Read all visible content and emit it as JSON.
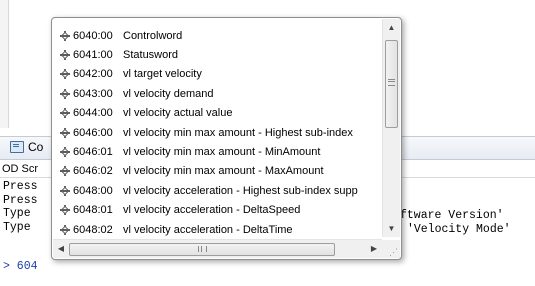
{
  "console": {
    "tab_label": "Co",
    "od_label": "OD Scr",
    "lines": [
      "Press",
      "Press",
      "Type",
      "Type"
    ],
    "right_text_1": "ftware Version'",
    "right_text_2": "'Velocity Mode'",
    "prompt": "> 604"
  },
  "popup": {
    "items": [
      {
        "index": "6040:00",
        "name": "Controlword"
      },
      {
        "index": "6041:00",
        "name": "Statusword"
      },
      {
        "index": "6042:00",
        "name": "vl target velocity"
      },
      {
        "index": "6043:00",
        "name": "vl velocity demand"
      },
      {
        "index": "6044:00",
        "name": "vl velocity actual value"
      },
      {
        "index": "6046:00",
        "name": "vl velocity min max amount - Highest sub-index"
      },
      {
        "index": "6046:01",
        "name": "vl velocity min max amount - MinAmount"
      },
      {
        "index": "6046:02",
        "name": "vl velocity min max amount - MaxAmount"
      },
      {
        "index": "6048:00",
        "name": "vl velocity acceleration - Highest sub-index supp"
      },
      {
        "index": "6048:01",
        "name": "vl velocity acceleration - DeltaSpeed"
      },
      {
        "index": "6048:02",
        "name": "vl velocity acceleration - DeltaTime"
      }
    ],
    "icon": "object-entry-icon"
  }
}
